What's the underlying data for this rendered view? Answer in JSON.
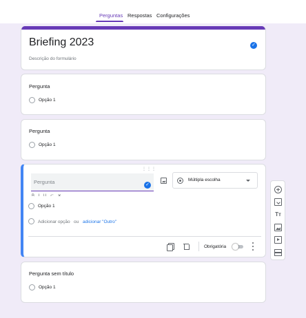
{
  "tabs": [
    {
      "label": "Perguntas",
      "active": true
    },
    {
      "label": "Respostas",
      "active": false
    },
    {
      "label": "Configurações",
      "active": false
    }
  ],
  "colors": {
    "accent": "#673ab7",
    "background": "#f0ebf8",
    "link": "#1a73e8",
    "active_card_border": "#4285f4"
  },
  "form": {
    "title": "Briefing 2023",
    "description_placeholder": "Descrição do formulário"
  },
  "questions": [
    {
      "title": "Pergunta",
      "options": [
        "Opção 1"
      ]
    },
    {
      "title": "Pergunta",
      "options": [
        "Opção 1"
      ]
    }
  ],
  "active_question": {
    "placeholder": "Pergunta",
    "type_label": "Múltipla escolha",
    "option": "Opção 1",
    "add_option": "Adicionar opção",
    "or_text": "ou",
    "add_other": "adicionar \"Outro\"",
    "required_label": "Obrigatória",
    "required": false
  },
  "last_question": {
    "title": "Pergunta sem título",
    "option": "Opção 1"
  },
  "toolbar_icons": [
    "add-question-icon",
    "import-questions-icon",
    "add-title-icon",
    "add-image-icon",
    "add-video-icon",
    "add-section-icon"
  ]
}
